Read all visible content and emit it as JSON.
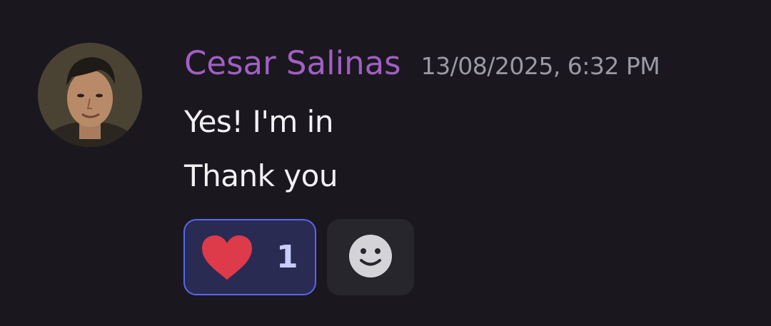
{
  "message": {
    "author": "Cesar Salinas",
    "timestamp": "13/08/2025, 6:32 PM",
    "lines": [
      "Yes! I'm in",
      "Thank you"
    ],
    "avatar_icon": "user-avatar-photo"
  },
  "reactions": [
    {
      "emoji": "heart-icon",
      "count": "1",
      "selected": true
    }
  ],
  "add_reaction": {
    "icon": "smiley-icon"
  },
  "colors": {
    "background": "#1a181e",
    "author": "#a15fc4",
    "timestamp": "#9a9aa3",
    "text": "#f2f2f5",
    "reaction_bg": "#2a2b52",
    "reaction_border": "#5865f2",
    "reaction_count": "#c9cdfb",
    "heart": "#dd3a4a",
    "add_reaction_bg": "#27262d"
  }
}
